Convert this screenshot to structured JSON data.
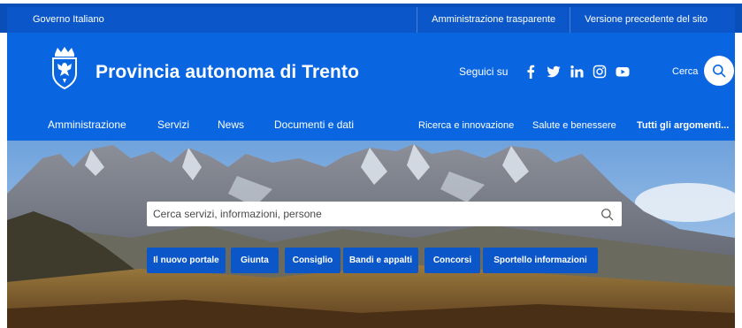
{
  "topbar": {
    "gov_label": "Governo Italiano",
    "links": [
      "Amministrazione trasparente",
      "Versione precedente del sito"
    ]
  },
  "header": {
    "title": "Provincia autonoma di Trento",
    "social_label": "Seguici su",
    "social_icons": [
      "facebook-icon",
      "twitter-icon",
      "linkedin-icon",
      "instagram-icon",
      "youtube-icon"
    ],
    "search_label": "Cerca"
  },
  "nav": {
    "main": [
      "Amministrazione",
      "Servizi",
      "News",
      "Documenti e dati"
    ],
    "topics": [
      "Ricerca e innovazione",
      "Salute e benessere"
    ],
    "all_topics": "Tutti gli argomenti..."
  },
  "hero": {
    "search_placeholder": "Cerca servizi, informazioni, persone",
    "quick_links": [
      "Il nuovo portale",
      "Giunta",
      "Consiglio",
      "Bandi e appalti",
      "Concorsi",
      "Sportello informazioni"
    ]
  },
  "colors": {
    "brand_blue": "#0966e0",
    "dark_blue": "#0b57c9",
    "white": "#ffffff"
  }
}
